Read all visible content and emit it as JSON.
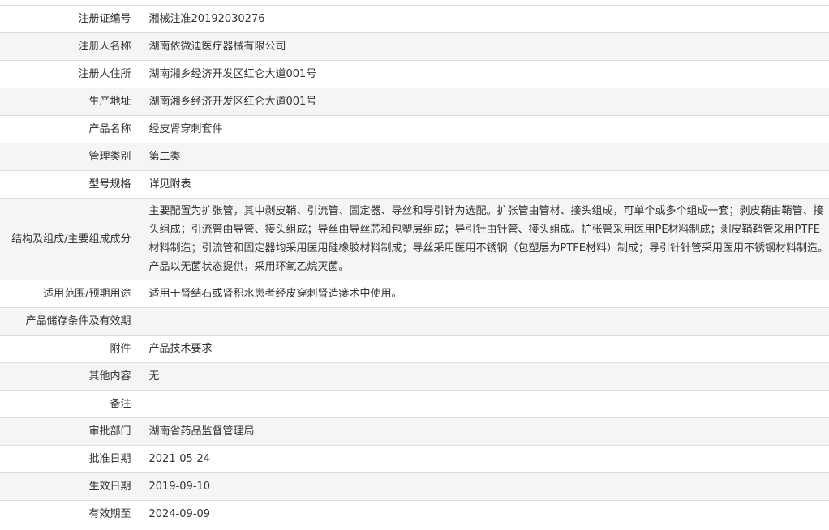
{
  "rows": [
    {
      "label": "注册证编号",
      "value": "湘械注准20192030276"
    },
    {
      "label": "注册人名称",
      "value": "湖南依微迪医疗器械有限公司"
    },
    {
      "label": "注册人住所",
      "value": "湖南湘乡经济开发区红仑大道001号"
    },
    {
      "label": "生产地址",
      "value": "湖南湘乡经济开发区红仑大道001号"
    },
    {
      "label": "产品名称",
      "value": "经皮肾穿刺套件"
    },
    {
      "label": "管理类别",
      "value": "第二类"
    },
    {
      "label": "型号规格",
      "value": "详见附表"
    },
    {
      "label": "结构及组成/主要组成成分",
      "value": "主要配置为扩张管，其中剥皮鞘、引流管、固定器、导丝和导引针为选配。扩张管由管材、接头组成，可单个或多个组成一套；剥皮鞘由鞘管、接头组成；引流管由导管、接头组成；导丝由导丝芯和包塑层组成；导引针由针管、接头组成。扩张管采用医用PE材料制成；剥皮鞘鞘管采用PTFE材料制造；引流管和固定器均采用医用硅橡胶材料制成；导丝采用医用不锈钢（包塑层为PTFE材料）制成；导引针针管采用医用不锈钢材料制造。产品以无菌状态提供，采用环氧乙烷灭菌。"
    },
    {
      "label": "适用范围/预期用途",
      "value": "适用于肾结石或肾积水患者经皮穿刺肾造瘘术中使用。"
    },
    {
      "label": "产品储存条件及有效期",
      "value": ""
    },
    {
      "label": "附件",
      "value": "产品技术要求"
    },
    {
      "label": "其他内容",
      "value": "无"
    },
    {
      "label": "备注",
      "value": ""
    },
    {
      "label": "审批部门",
      "value": "湖南省药品监督管理局"
    },
    {
      "label": "批准日期",
      "value": "2021-05-24"
    },
    {
      "label": "生效日期",
      "value": "2019-09-10"
    },
    {
      "label": "有效期至",
      "value": "2024-09-09"
    }
  ]
}
